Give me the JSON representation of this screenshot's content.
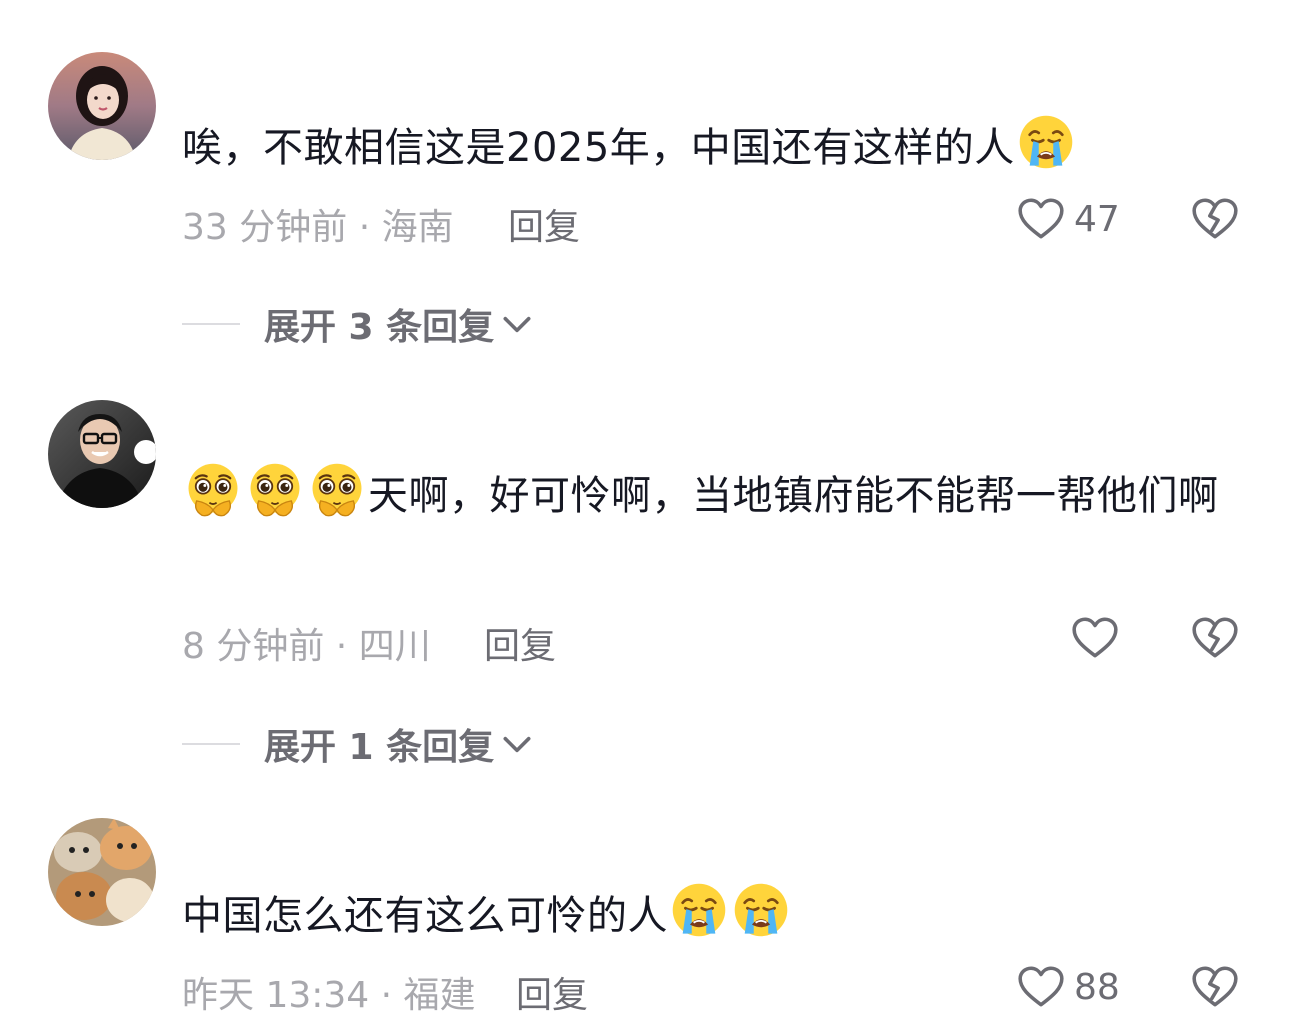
{
  "comments": [
    {
      "avatar": "avatar-woman",
      "text_before": "唉，不敢相信这是2025年，中国还有这样的人",
      "emoji_before_count": 0,
      "emoji_after": [
        "loudly-crying-face"
      ],
      "time": "33 分钟前",
      "sep": " · ",
      "location": "海南",
      "reply_label": "回复",
      "likes": "47",
      "expand_label": "展开 3 条回复"
    },
    {
      "avatar": "avatar-man-glasses",
      "emoji_before": [
        "pleading-hands-face",
        "pleading-hands-face",
        "pleading-hands-face"
      ],
      "text": "天啊，好可怜啊，当地镇府能不能帮一帮他们啊",
      "time": "8 分钟前",
      "sep": " · ",
      "location": "四川",
      "reply_label": "回复",
      "likes": "",
      "expand_label": "展开 1 条回复"
    },
    {
      "avatar": "avatar-kittens",
      "text": "中国怎么还有这么可怜的人",
      "emoji_after": [
        "loudly-crying-face",
        "loudly-crying-face"
      ],
      "time": "昨天 13:34",
      "sep": " · ",
      "location": "福建",
      "reply_label": "回复",
      "likes": "88"
    }
  ],
  "icons": {
    "like": "heart-outline-icon",
    "dislike": "broken-heart-icon",
    "expand": "chevron-down-icon"
  },
  "colors": {
    "text": "#161823",
    "meta": "#a8a8ad",
    "action": "#6c6c73"
  }
}
